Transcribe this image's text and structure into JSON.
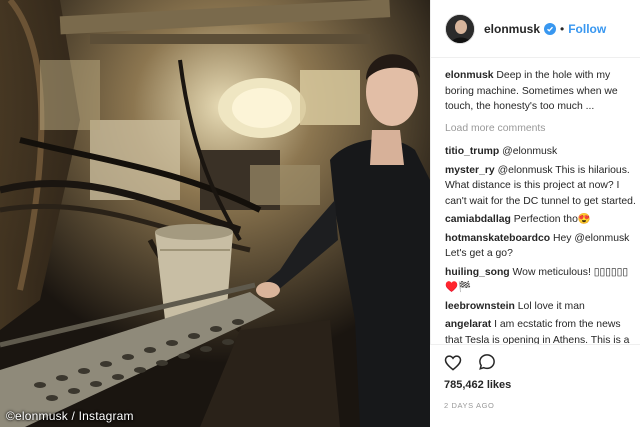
{
  "photo": {
    "watermark": "©elonmusk / Instagram"
  },
  "header": {
    "username": "elonmusk",
    "separator": "•",
    "follow_label": "Follow"
  },
  "caption": {
    "username": "elonmusk",
    "text": "Deep in the hole with my boring machine. Sometimes when we touch, the honesty's too much ..."
  },
  "load_more_label": "Load more comments",
  "comments": [
    {
      "user": "titio_trump",
      "text": "@elonmusk"
    },
    {
      "user": "myster_ry",
      "text": "@elonmusk This is hilarious. What distance is this project at now? I can't wait for the DC tunnel to get started."
    },
    {
      "user": "camiabdallag",
      "text": "Perfection tho😍"
    },
    {
      "user": "hotmanskateboardco",
      "text": "Hey @elonmusk Let's get a go?"
    },
    {
      "user": "huiling_song",
      "text": "Wow meticulous! ▯▯▯▯▯▯ ♥️🏁"
    },
    {
      "user": "leebrownstein",
      "text": "Lol love it man"
    },
    {
      "user": "angelarat",
      "text": "I am ecstatic from the news that Tesla is opening in Athens. This is a turning point for energy in Greece, and it also has"
    }
  ],
  "actions": {
    "icons": [
      "heart-icon",
      "comment-icon"
    ],
    "likes": "785,462 likes",
    "posted": "2 DAYS AGO"
  },
  "colors": {
    "link": "#3897f0",
    "verified": "#3897f0",
    "muted": "#999999",
    "text": "#262626"
  }
}
